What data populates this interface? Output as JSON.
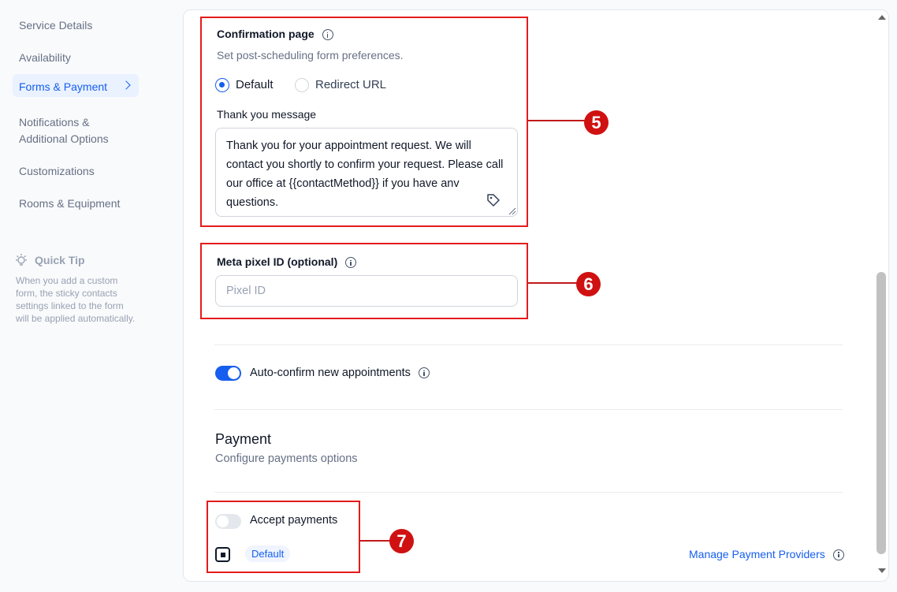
{
  "sidebar": {
    "items": [
      {
        "label": "Service Details"
      },
      {
        "label": "Availability"
      },
      {
        "label": "Forms & Payment"
      },
      {
        "label": "Notifications & Additional Options"
      },
      {
        "label": "Customizations"
      },
      {
        "label": "Rooms & Equipment"
      }
    ],
    "active_index": 2,
    "quick_tip": {
      "title": "Quick Tip",
      "text": "When you add a custom form, the sticky contacts settings linked to the form will be applied automatically."
    }
  },
  "confirmation": {
    "title": "Confirmation page",
    "subtitle": "Set post-scheduling form preferences.",
    "options": [
      {
        "label": "Default",
        "selected": true
      },
      {
        "label": "Redirect URL",
        "selected": false
      }
    ],
    "thank_you_label": "Thank you message",
    "thank_you_value": "Thank you for your appointment request. We will contact you shortly to confirm your request. Please call our office at {{contactMethod}} if you have anv questions."
  },
  "meta_pixel": {
    "label": "Meta pixel ID (optional)",
    "placeholder": "Pixel ID",
    "value": ""
  },
  "auto_confirm": {
    "label": "Auto-confirm new appointments",
    "enabled": true
  },
  "payment": {
    "title": "Payment",
    "subtitle": "Configure payments options",
    "accept_label": "Accept payments",
    "accept_enabled": false,
    "provider_badge": "Default",
    "manage_link": "Manage Payment Providers"
  },
  "annotations": [
    "5",
    "6",
    "7"
  ],
  "colors": {
    "accent": "#155eef",
    "annotation": "#e41b1b"
  }
}
